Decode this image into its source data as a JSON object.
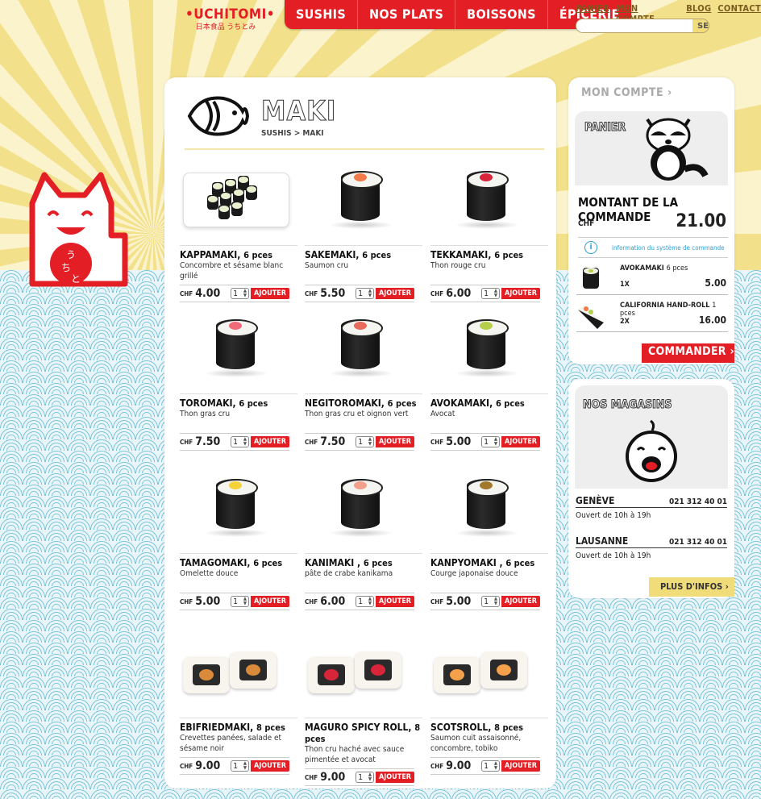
{
  "brand": {
    "name": "UCHITOMI",
    "subtitle": "日本食品 うちとみ"
  },
  "main_nav": [
    "SUSHIS",
    "NOS PLATS",
    "BOISSONS",
    "ÉPICERIE"
  ],
  "top_nav": [
    "PANIER",
    "MON COMPTE",
    "BLOG",
    "CONTACT"
  ],
  "search": {
    "placeholder": "",
    "button": "SEARCH"
  },
  "page": {
    "title": "MAKI",
    "breadcrumb": "SUSHIS > MAKI"
  },
  "products": [
    {
      "name": "KAPPAMAKI,",
      "pieces": "6 pces",
      "desc": "Concombre et sésame blanc grillé",
      "price": "4.00",
      "qty": "1",
      "filling": "#a8c35a",
      "kind": "plate"
    },
    {
      "name": "SAKEMAKI,",
      "pieces": "6 pces",
      "desc": "Saumon cru",
      "price": "5.50",
      "qty": "1",
      "filling": "#f27a4a",
      "kind": "roll"
    },
    {
      "name": "TEKKAMAKI,",
      "pieces": "6 pces",
      "desc": "Thon rouge cru",
      "price": "6.00",
      "qty": "1",
      "filling": "#d9253a",
      "kind": "roll"
    },
    {
      "name": "TOROMAKI,",
      "pieces": "6 pces",
      "desc": "Thon gras cru",
      "price": "7.50",
      "qty": "1",
      "filling": "#f06a7a",
      "kind": "roll"
    },
    {
      "name": "NEGITOROMAKI,",
      "pieces": "6 pces",
      "desc": "Thon gras cru et oignon vert",
      "price": "7.50",
      "qty": "1",
      "filling": "#e86a5a",
      "kind": "roll"
    },
    {
      "name": "AVOKAMAKI,",
      "pieces": "6 pces",
      "desc": "Avocat",
      "price": "5.00",
      "qty": "1",
      "filling": "#b5cf4a",
      "kind": "roll"
    },
    {
      "name": "TAMAGOMAKI,",
      "pieces": "6 pces",
      "desc": "Omelette douce",
      "price": "5.00",
      "qty": "1",
      "filling": "#f5d23a",
      "kind": "roll"
    },
    {
      "name": "KANIMAKI ,",
      "pieces": "6 pces",
      "desc": "pâte de crabe kanikama",
      "price": "6.00",
      "qty": "1",
      "filling": "#f2a08a",
      "kind": "roll"
    },
    {
      "name": "KANPYOMAKI ,",
      "pieces": "6 pces",
      "desc": "Courge japonaise douce",
      "price": "5.00",
      "qty": "1",
      "filling": "#a07a2a",
      "kind": "roll"
    },
    {
      "name": "EBIFRIEDMAKI,",
      "pieces": "8 pces",
      "desc": "Crevettes panées, salade et sésame noir",
      "price": "9.00",
      "qty": "1",
      "filling": "#d98a3a",
      "kind": "uramaki"
    },
    {
      "name": "MAGURO SPICY ROLL,",
      "pieces": "8 pces",
      "desc": "Thon cru haché avec sauce pimentée et avocat",
      "price": "9.00",
      "qty": "1",
      "filling": "#d9253a",
      "kind": "uramaki"
    },
    {
      "name": "SCOTSROLL,",
      "pieces": "8 pces",
      "desc": "Saumon cuit assaisonné, concombre, tobiko",
      "price": "9.00",
      "qty": "1",
      "filling": "#f5a04a",
      "kind": "uramaki"
    }
  ],
  "labels": {
    "currency": "CHF",
    "add": "AJOUTER"
  },
  "account": {
    "label": "MON COMPTE"
  },
  "cart": {
    "title": "PANIER",
    "amount_label": "MONTANT DE LA COMMANDE",
    "currency": "CHF",
    "total": "21.00",
    "info": "information du système de commande",
    "items": [
      {
        "name": "AVOKAMAKI",
        "pieces": "6 pces",
        "qty": "1X",
        "price": "5.00"
      },
      {
        "name": "CALIFORNIA HAND-ROLL",
        "pieces": "1 pces",
        "qty": "2X",
        "price": "16.00"
      }
    ],
    "order_button": "COMMANDER"
  },
  "stores": {
    "title": "NOS MAGASINS",
    "list": [
      {
        "city": "GENÈVE",
        "phone": "021 312 40 01",
        "hours": "Ouvert de 10h à 19h"
      },
      {
        "city": "LAUSANNE",
        "phone": "021 312 40 01",
        "hours": "Ouvert de 10h à 19h"
      }
    ],
    "more": "PLUS D'INFOS"
  },
  "colors": {
    "accent": "#e31e24",
    "yellow": "#f0dd7a",
    "info": "#2b9fd4"
  }
}
